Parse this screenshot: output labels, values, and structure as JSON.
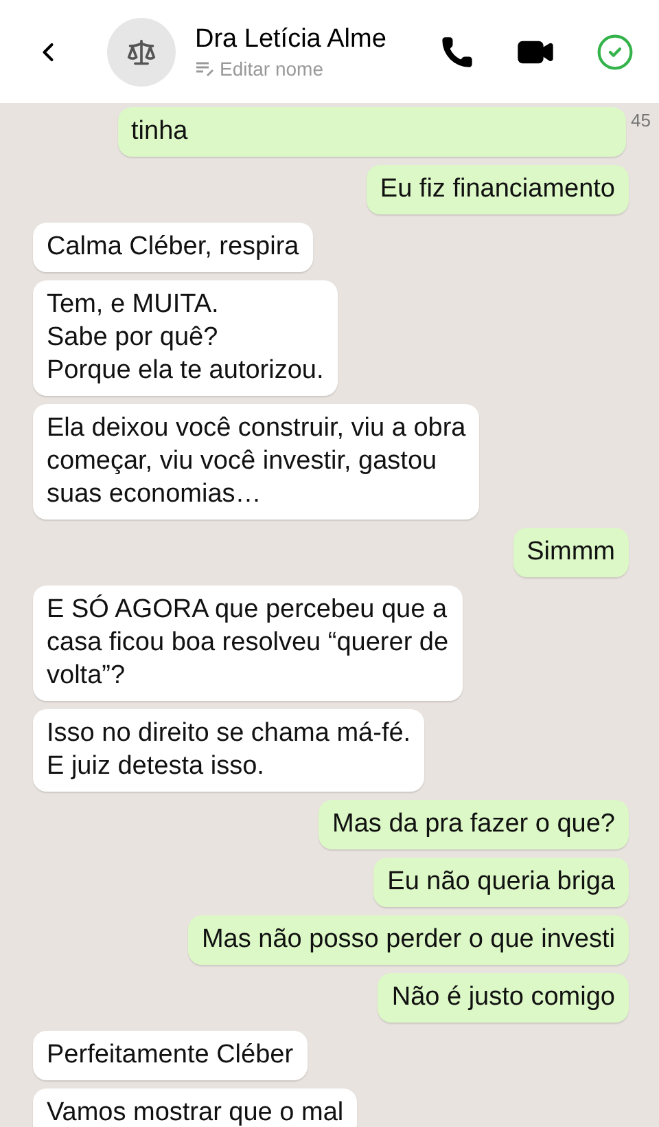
{
  "header": {
    "contact_name": "Dra Letícia Alme",
    "subtitle": "Editar nome"
  },
  "messages": [
    {
      "kind": "outgoing",
      "text": "tinha",
      "time": "45"
    },
    {
      "kind": "outgoing",
      "text": "Eu fiz financiamento"
    },
    {
      "kind": "incoming",
      "text": "Calma Cléber, respira"
    },
    {
      "kind": "incoming",
      "text": "Tem, e MUITA.\nSabe por quê?\nPorque ela te autorizou."
    },
    {
      "kind": "incoming",
      "text": "Ela deixou você construir, viu a obra\ncomeçar, viu você investir, gastou\nsuas economias…"
    },
    {
      "kind": "outgoing",
      "text": "Simmm"
    },
    {
      "kind": "incoming",
      "text": "E SÓ AGORA que percebeu que a\ncasa ficou boa resolveu “querer de\nvolta”?"
    },
    {
      "kind": "incoming",
      "text": "Isso no direito se chama má-fé.\nE juiz detesta isso."
    },
    {
      "kind": "outgoing",
      "text": "Mas da pra fazer o que?"
    },
    {
      "kind": "outgoing",
      "text": "Eu não queria briga"
    },
    {
      "kind": "outgoing",
      "text": "Mas não posso perder o que investi"
    },
    {
      "kind": "outgoing",
      "text": "Não é justo comigo"
    },
    {
      "kind": "incoming",
      "text": "Perfeitamente Cléber"
    },
    {
      "kind": "incoming",
      "text": "Vamos mostrar que o mal"
    }
  ]
}
